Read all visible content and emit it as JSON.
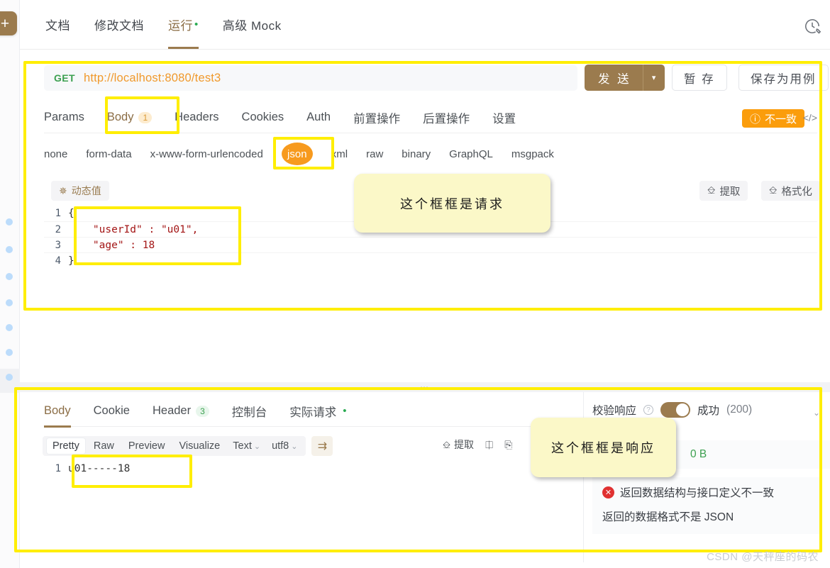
{
  "left_rail": {
    "add_label": "+",
    "dots_count": 7
  },
  "topnav": {
    "items": [
      {
        "label": "文档",
        "active": false,
        "dot": false
      },
      {
        "label": "修改文档",
        "active": false,
        "dot": false
      },
      {
        "label": "运行",
        "active": true,
        "dot": true
      },
      {
        "label": "高级 Mock",
        "active": false,
        "dot": false
      }
    ],
    "history_icon": "history-edit-icon"
  },
  "request": {
    "method": "GET",
    "url": "http://localhost:8080/test3",
    "send_label": "发 送",
    "send_caret_icon": "chevron-down-icon",
    "stash_label": "暂 存",
    "save_case_label": "保存为用例",
    "tabs": [
      {
        "label": "Params",
        "count": "",
        "active": false
      },
      {
        "label": "Body",
        "count": "1",
        "active": true
      },
      {
        "label": "Headers",
        "count": "",
        "active": false
      },
      {
        "label": "Cookies",
        "count": "",
        "active": false
      },
      {
        "label": "Auth",
        "count": "",
        "active": false
      },
      {
        "label": "前置操作",
        "count": "",
        "active": false
      },
      {
        "label": "后置操作",
        "count": "",
        "active": false
      },
      {
        "label": "设置",
        "count": "",
        "active": false
      }
    ],
    "mismatch_badge": {
      "icon": "exclamation-circle-icon",
      "label": "不一致",
      "color": "#fb9d0c"
    },
    "code_icon": "code-brackets-icon",
    "body_types": [
      {
        "label": "none",
        "selected": false
      },
      {
        "label": "form-data",
        "selected": false
      },
      {
        "label": "x-www-form-urlencoded",
        "selected": false
      },
      {
        "label": "json",
        "selected": true
      },
      {
        "label": "xml",
        "selected": false
      },
      {
        "label": "raw",
        "selected": false
      },
      {
        "label": "binary",
        "selected": false
      },
      {
        "label": "GraphQL",
        "selected": false
      },
      {
        "label": "msgpack",
        "selected": false
      }
    ],
    "dynamic_value_label": "动态值",
    "dynamic_value_icon": "magic-wand-icon",
    "extract_label": "提取",
    "extract_icon": "extract-box-icon",
    "format_label": "格式化",
    "format_icon": "format-icon",
    "editor_lines": [
      {
        "no": "1",
        "code": "{"
      },
      {
        "no": "2",
        "code": "    \"userId\" : \"u01\","
      },
      {
        "no": "3",
        "code": "    \"age\" : 18"
      },
      {
        "no": "4",
        "code": "}"
      }
    ]
  },
  "splitter": {
    "handle": "⋯"
  },
  "response": {
    "tabs": [
      {
        "label": "Body",
        "count": "",
        "active": true,
        "dot": false
      },
      {
        "label": "Cookie",
        "count": "",
        "active": false,
        "dot": false
      },
      {
        "label": "Header",
        "count": "3",
        "active": false,
        "dot": false
      },
      {
        "label": "控制台",
        "count": "",
        "active": false,
        "dot": false
      },
      {
        "label": "实际请求",
        "count": "",
        "active": false,
        "dot": true
      }
    ],
    "view_modes": [
      {
        "label": "Pretty",
        "active": true
      },
      {
        "label": "Raw",
        "active": false
      },
      {
        "label": "Preview",
        "active": false
      },
      {
        "label": "Visualize",
        "active": false
      }
    ],
    "format_select": "Text",
    "charset_select": "utf8",
    "wrap_icon": "word-wrap-icon",
    "actions": [
      {
        "label": "提取",
        "icon": "extract-box-icon"
      },
      {
        "label": "",
        "icon": "download-icon"
      },
      {
        "label": "",
        "icon": "copy-icon"
      }
    ],
    "body_lines": [
      {
        "no": "1",
        "code": "u01-----18"
      }
    ],
    "verify": {
      "title": "校验响应",
      "help_icon": "question-circle-icon",
      "toggle_on": true,
      "status_text": "成功",
      "status_code": "(200)",
      "collapse_icon": "chevron-down-icon",
      "size": "0 B",
      "errors": [
        {
          "icon": "error-circle-icon",
          "text": "返回数据结构与接口定义不一致"
        },
        {
          "icon": "",
          "text": "返回的数据格式不是 JSON"
        }
      ]
    }
  },
  "annotations": {
    "note_request": "这个框框是请求",
    "note_response": "这个框框是响应"
  },
  "watermark": "CSDN @天秤座的码农",
  "colors": {
    "brand": "#9b7b4e",
    "accent_orange": "#f79a1e",
    "highlight_yellow": "#ffee00",
    "note_bg": "#fbf8c8",
    "success_green": "#3ca050",
    "error_red": "#e03131"
  }
}
